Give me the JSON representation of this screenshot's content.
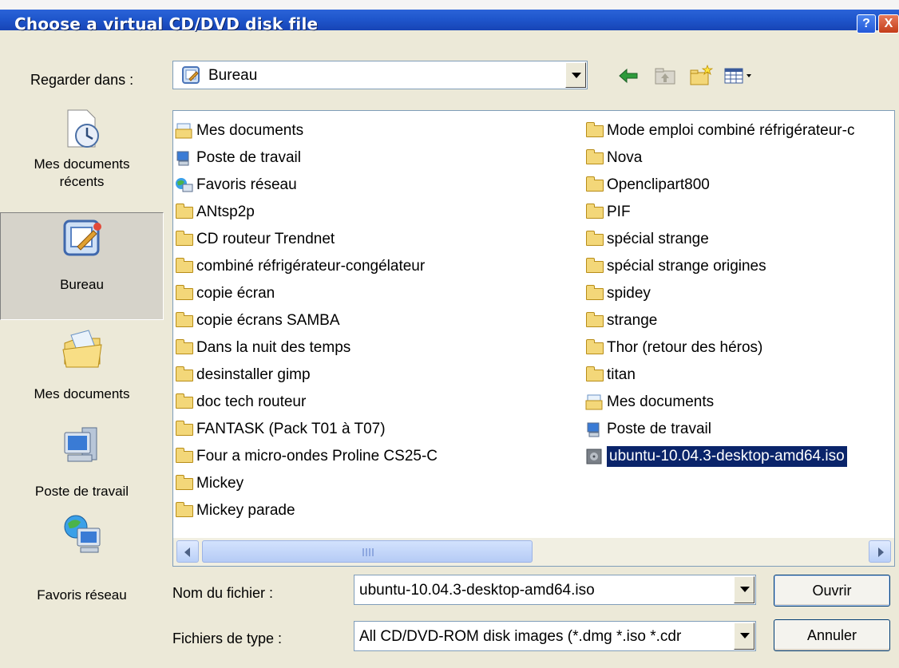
{
  "window": {
    "title": "Choose a virtual CD/DVD disk file",
    "help_button": "?",
    "close_button": "X"
  },
  "lookin": {
    "label": "Regarder dans :",
    "value": "Bureau"
  },
  "toolbar": {
    "back_icon": "back-arrow-icon",
    "up_icon": "up-folder-icon",
    "new_folder_icon": "new-folder-icon",
    "view_menu_icon": "view-menu-icon"
  },
  "places": [
    {
      "label": "Mes documents\nrécents",
      "icon": "recent-documents-icon",
      "selected": false
    },
    {
      "label": "Bureau",
      "icon": "desktop-icon",
      "selected": true
    },
    {
      "label": "Mes documents",
      "icon": "my-documents-icon",
      "selected": false
    },
    {
      "label": "Poste de travail",
      "icon": "my-computer-icon",
      "selected": false
    },
    {
      "label": "Favoris réseau",
      "icon": "network-places-icon",
      "selected": false
    }
  ],
  "files": {
    "column1": [
      {
        "name": "Mes documents",
        "icon": "my-documents-icon"
      },
      {
        "name": "Poste de travail",
        "icon": "my-computer-icon"
      },
      {
        "name": "Favoris réseau",
        "icon": "network-places-icon"
      },
      {
        "name": "ANtsp2p",
        "icon": "folder-icon"
      },
      {
        "name": "CD routeur Trendnet",
        "icon": "folder-icon"
      },
      {
        "name": "combiné réfrigérateur-congélateur",
        "icon": "folder-icon"
      },
      {
        "name": "copie écran",
        "icon": "folder-icon"
      },
      {
        "name": "copie écrans SAMBA",
        "icon": "folder-icon"
      },
      {
        "name": "Dans la nuit des temps",
        "icon": "folder-icon"
      },
      {
        "name": "desinstaller gimp",
        "icon": "folder-icon"
      },
      {
        "name": "doc tech routeur",
        "icon": "folder-icon"
      },
      {
        "name": "FANTASK (Pack T01 à T07)",
        "icon": "folder-icon"
      },
      {
        "name": "Four a micro-ondes Proline CS25-C",
        "icon": "folder-icon"
      },
      {
        "name": "Mickey",
        "icon": "folder-icon"
      },
      {
        "name": "Mickey parade",
        "icon": "folder-icon"
      }
    ],
    "column2": [
      {
        "name": "Mode emploi combiné réfrigérateur-c",
        "icon": "folder-icon"
      },
      {
        "name": "Nova",
        "icon": "folder-icon"
      },
      {
        "name": "Openclipart800",
        "icon": "folder-icon"
      },
      {
        "name": "PIF",
        "icon": "folder-icon"
      },
      {
        "name": "spécial strange",
        "icon": "folder-icon"
      },
      {
        "name": "spécial strange origines",
        "icon": "folder-icon"
      },
      {
        "name": "spidey",
        "icon": "folder-icon"
      },
      {
        "name": "strange",
        "icon": "folder-icon"
      },
      {
        "name": "Thor (retour des héros)",
        "icon": "folder-icon"
      },
      {
        "name": "titan",
        "icon": "folder-icon"
      },
      {
        "name": "Mes documents",
        "icon": "my-documents-icon"
      },
      {
        "name": "Poste de travail",
        "icon": "my-computer-icon"
      },
      {
        "name": "ubuntu-10.04.3-desktop-amd64.iso",
        "icon": "disk-image-icon",
        "selected": true
      }
    ]
  },
  "scrollbar": {
    "left_icon": "scroll-left-icon",
    "right_icon": "scroll-right-icon"
  },
  "filename": {
    "label": "Nom du fichier :",
    "value": "ubuntu-10.04.3-desktop-amd64.iso"
  },
  "filetype": {
    "label": "Fichiers de type :",
    "value": "All CD/DVD-ROM disk images (*.dmg *.iso *.cdr"
  },
  "buttons": {
    "open": "Ouvrir",
    "cancel": "Annuler"
  },
  "colors": {
    "titlebar": "#2b63d8",
    "selection": "#0a246a",
    "dialog_bg": "#ece9d8"
  }
}
